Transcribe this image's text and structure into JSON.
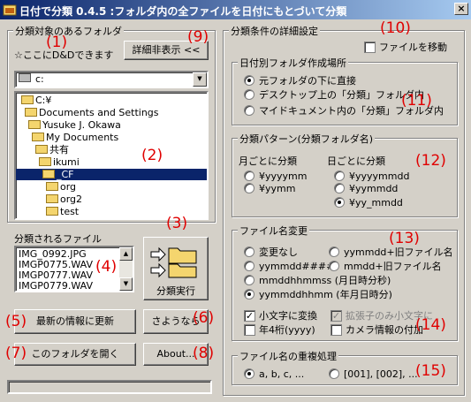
{
  "window": {
    "title": "日付で分類 0.4.5 :フォルダ内の全ファイルを日付にもとづいて分類",
    "close_glyph": "×"
  },
  "left": {
    "folder_group": "分類対象のあるフォルダ",
    "dnd_hint": "☆ここにD&Dできます",
    "details_button": "詳細非表示 <<",
    "drive": "c:",
    "tree": [
      "C:¥",
      "Documents and Settings",
      "Yusuke J. Okawa",
      "My Documents",
      "共有",
      "ikumi",
      "_CF",
      "org",
      "org2",
      "test"
    ],
    "files_label": "分類されるファイル",
    "files": [
      "IMG_0992.JPG",
      "IMGP0775.WAV",
      "IMGP0777.WAV",
      "IMGP0779.WAV"
    ],
    "run_button": "分類実行",
    "refresh_button": "最新の情報に更新",
    "bye_button": "さようなら",
    "open_folder_button": "このフォルダを開く",
    "about_button": "About..."
  },
  "right": {
    "settings_group": "分類条件の詳細設定",
    "move_files": "ファイルを移動",
    "location_group": "日付別フォルダ作成場所",
    "location_options": [
      "元フォルダの下に直接",
      "デスクトップ上の「分類」フォルダ内",
      "マイドキュメント内の「分類」フォルダ内"
    ],
    "pattern_group": "分類パターン(分類フォルダ名)",
    "monthly_label": "月ごとに分類",
    "monthly_options": [
      "¥yyyymm",
      "¥yymm"
    ],
    "daily_label": "日ごとに分類",
    "daily_options": [
      "¥yyyymmdd",
      "¥yymmdd",
      "¥yy_mmdd"
    ],
    "rename_group": "ファイル名変更",
    "rename_options": [
      "変更なし",
      "yymmdd+旧ファイル名",
      "yymmdd####",
      "mmdd+旧ファイル名",
      "mmddhhmmss (月日時分秒)",
      "yymmddhhmm (年月日時分)"
    ],
    "lowercase": "小文字に変換",
    "ext_only": "拡張子のみ小文字に",
    "year4": "年4桁(yyyy)",
    "camera": "カメラ情報の付加",
    "dup_group": "ファイル名の重複処理",
    "dup_options": [
      "a, b, c, ...",
      "[001], [002], ..."
    ]
  },
  "annotations": [
    "(1)",
    "(2)",
    "(3)",
    "(4)",
    "(5)",
    "(6)",
    "(7)",
    "(8)",
    "(9)",
    "(10)",
    "(11)",
    "(12)",
    "(13)",
    "(14)",
    "(15)"
  ]
}
